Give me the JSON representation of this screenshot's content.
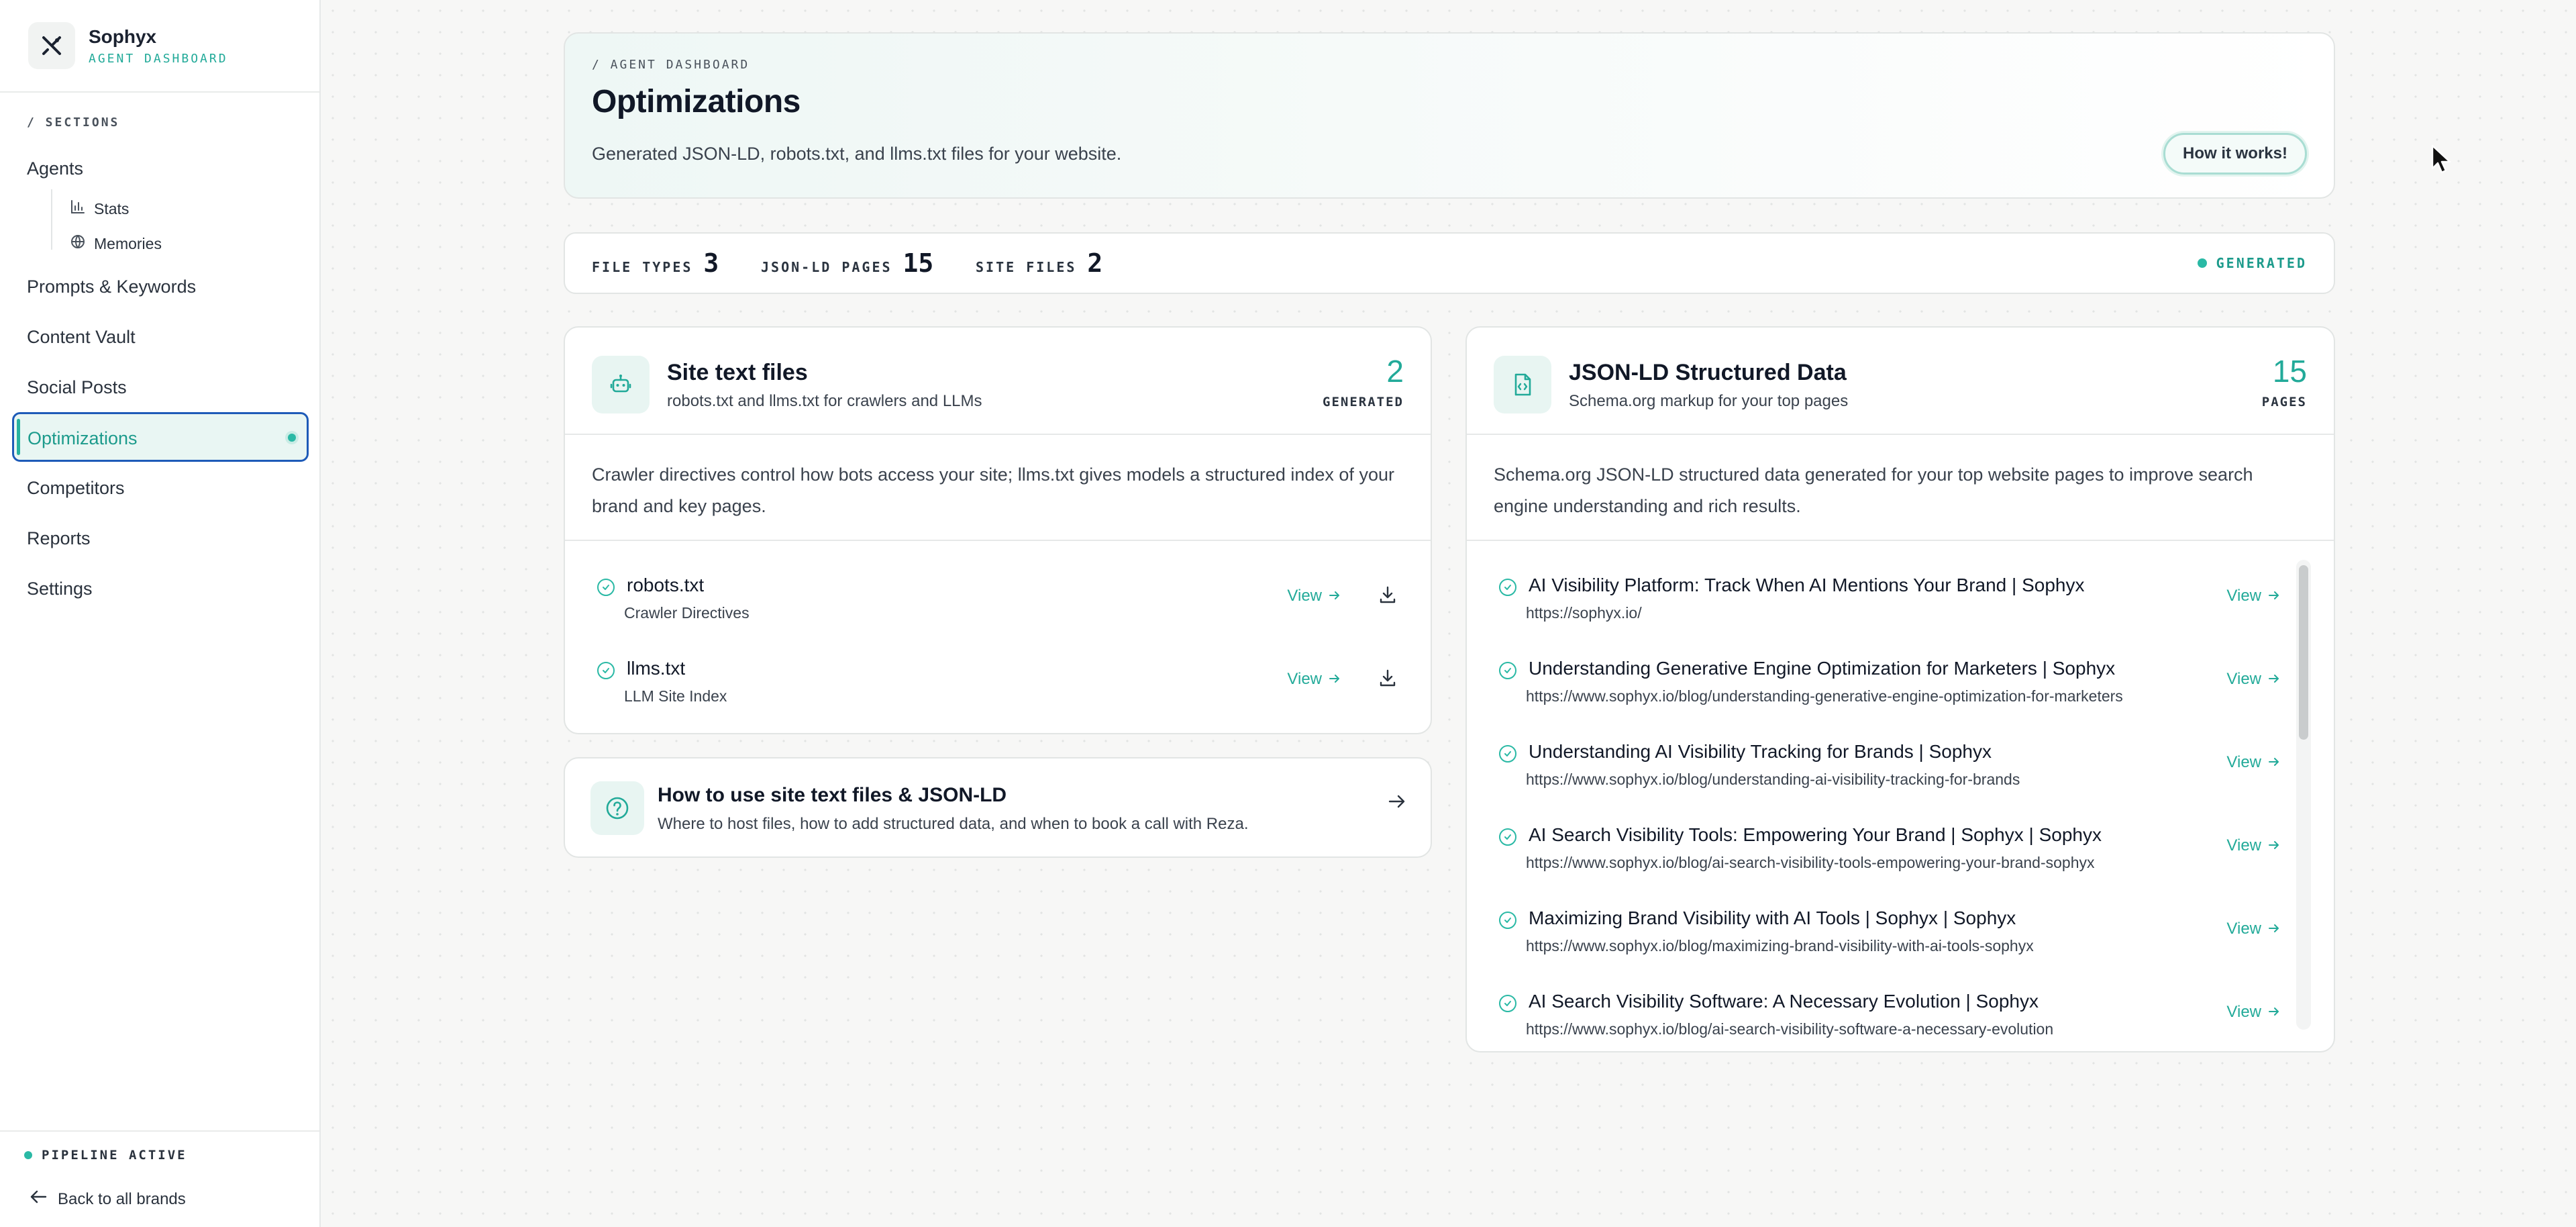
{
  "brand": {
    "name": "Sophyx",
    "subtitle": "AGENT DASHBOARD"
  },
  "sidebar": {
    "section_label": "/ SECTIONS",
    "items": [
      {
        "label": "Agents"
      },
      {
        "label": "Stats"
      },
      {
        "label": "Memories"
      },
      {
        "label": "Prompts & Keywords"
      },
      {
        "label": "Content Vault"
      },
      {
        "label": "Social Posts"
      },
      {
        "label": "Optimizations",
        "active": true
      },
      {
        "label": "Competitors"
      },
      {
        "label": "Reports"
      },
      {
        "label": "Settings"
      }
    ],
    "pipeline_status": "PIPELINE ACTIVE",
    "back_label": "Back to all brands"
  },
  "header": {
    "breadcrumb": "/ AGENT DASHBOARD",
    "title": "Optimizations",
    "description": "Generated JSON-LD, robots.txt, and llms.txt files for your website.",
    "how_button": "How it works!"
  },
  "stats": {
    "items": [
      {
        "label": "FILE TYPES",
        "value": "3"
      },
      {
        "label": "JSON-LD PAGES",
        "value": "15"
      },
      {
        "label": "SITE FILES",
        "value": "2"
      }
    ],
    "status": "GENERATED"
  },
  "site_files": {
    "title": "Site text files",
    "subtitle": "robots.txt and llms.txt for crawlers and LLMs",
    "count": "2",
    "count_label": "GENERATED",
    "description": "Crawler directives control how bots access your site; llms.txt gives models a structured index of your brand and key pages.",
    "files": [
      {
        "name": "robots.txt",
        "type": "Crawler Directives",
        "view_label": "View"
      },
      {
        "name": "llms.txt",
        "type": "LLM Site Index",
        "view_label": "View"
      }
    ]
  },
  "help": {
    "title": "How to use site text files & JSON-LD",
    "subtitle": "Where to host files, how to add structured data, and when to book a call with Reza."
  },
  "jsonld": {
    "title": "JSON-LD Structured Data",
    "subtitle": "Schema.org markup for your top pages",
    "count": "15",
    "count_label": "PAGES",
    "description": "Schema.org JSON-LD structured data generated for your top website pages to improve search engine understanding and rich results.",
    "pages": [
      {
        "title": "AI Visibility Platform: Track When AI Mentions Your Brand | Sophyx",
        "url": "https://sophyx.io/",
        "view_label": "View"
      },
      {
        "title": "Understanding Generative Engine Optimization for Marketers | Sophyx",
        "url": "https://www.sophyx.io/blog/understanding-generative-engine-optimization-for-marketers",
        "view_label": "View"
      },
      {
        "title": "Understanding AI Visibility Tracking for Brands | Sophyx",
        "url": "https://www.sophyx.io/blog/understanding-ai-visibility-tracking-for-brands",
        "view_label": "View"
      },
      {
        "title": "AI Search Visibility Tools: Empowering Your Brand | Sophyx | Sophyx",
        "url": "https://www.sophyx.io/blog/ai-search-visibility-tools-empowering-your-brand-sophyx",
        "view_label": "View"
      },
      {
        "title": "Maximizing Brand Visibility with AI Tools | Sophyx | Sophyx",
        "url": "https://www.sophyx.io/blog/maximizing-brand-visibility-with-ai-tools-sophyx",
        "view_label": "View"
      },
      {
        "title": "AI Search Visibility Software: A Necessary Evolution | Sophyx",
        "url": "https://www.sophyx.io/blog/ai-search-visibility-software-a-necessary-evolution",
        "view_label": "View"
      }
    ]
  },
  "colors": {
    "accent": "#22aa99",
    "active_border": "#1e5bb8"
  },
  "icons": {
    "logo": "sophyx-logo-icon",
    "stats": "bar-chart-icon",
    "memories": "globe-icon",
    "robot": "robot-icon",
    "file_code": "file-code-icon",
    "help": "question-circle-icon",
    "check": "check-circle-icon",
    "download": "download-icon",
    "arrow": "arrow-right-icon",
    "back": "arrow-left-icon"
  }
}
